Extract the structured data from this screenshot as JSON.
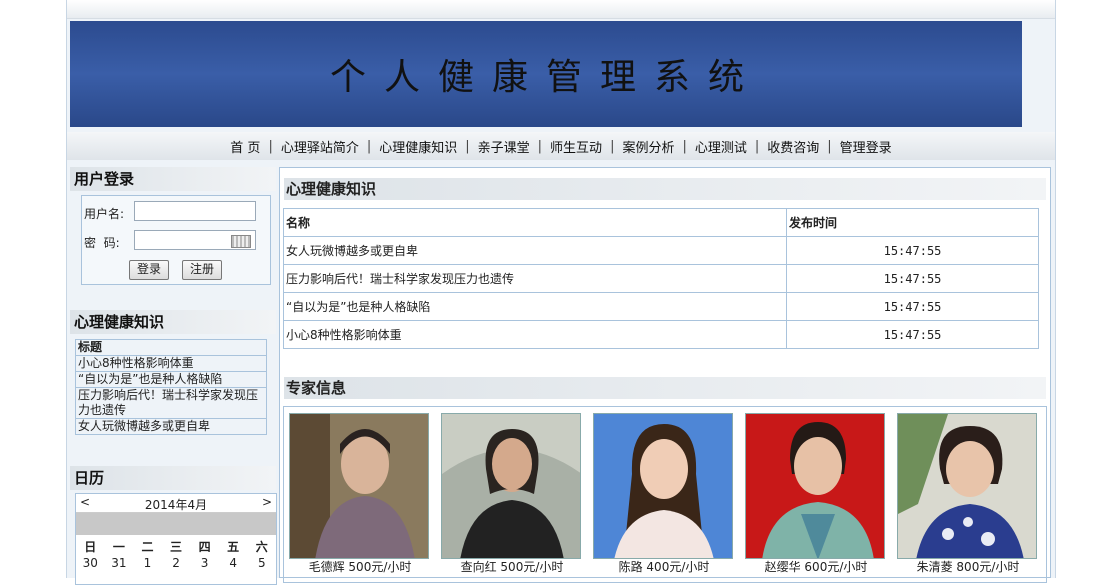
{
  "banner": {
    "title": "个人健康管理系统"
  },
  "nav": [
    "首 页",
    "心理驿站简介",
    "心理健康知识",
    "亲子课堂",
    "师生互动",
    "案例分析",
    "心理测试",
    "收费咨询",
    "管理登录"
  ],
  "login": {
    "heading": "用户登录",
    "username_label": "用户名:",
    "password_label": "密  码:",
    "username_value": "",
    "password_value": "",
    "login_button": "登录",
    "register_button": "注册"
  },
  "side_knowledge": {
    "heading": "心理健康知识",
    "column": "标题",
    "items": [
      "小心8种性格影响体重",
      "“自以为是”也是种人格缺陷",
      "压力影响后代！瑞士科学家发现压力也遗传",
      "女人玩微博越多或更自卑"
    ]
  },
  "calendar": {
    "heading": "日历",
    "month_label": "2014年4月",
    "prev": "<",
    "next": ">",
    "weekdays": [
      "日",
      "一",
      "二",
      "三",
      "四",
      "五",
      "六"
    ],
    "first_row": [
      "30",
      "31",
      "1",
      "2",
      "3",
      "4",
      "5"
    ]
  },
  "main_knowledge": {
    "heading": "心理健康知识",
    "col_name": "名称",
    "col_time": "发布时间",
    "rows": [
      {
        "name": "女人玩微博越多或更自卑",
        "time": "15:47:55"
      },
      {
        "name": "压力影响后代！瑞士科学家发现压力也遗传",
        "time": "15:47:55"
      },
      {
        "name": "“自以为是”也是种人格缺陷",
        "time": "15:47:55"
      },
      {
        "name": "小心8种性格影响体重",
        "time": "15:47:55"
      }
    ]
  },
  "experts": {
    "heading": "专家信息",
    "list": [
      {
        "caption": "毛德辉 500元/小时",
        "bg": "#8a7a5e",
        "face": "#d9b49a"
      },
      {
        "caption": "查向红 500元/小时",
        "bg": "#a9b0a6",
        "face": "#d4a98c"
      },
      {
        "caption": "陈路 400元/小时",
        "bg": "#4e86d6",
        "face": "#f0cdb6"
      },
      {
        "caption": "赵缨华 600元/小时",
        "bg": "#c81818",
        "face": "#e7c1a6"
      },
      {
        "caption": "朱清菱 800元/小时",
        "bg": "#6f8f5a",
        "face": "#e8c4aa"
      }
    ]
  }
}
